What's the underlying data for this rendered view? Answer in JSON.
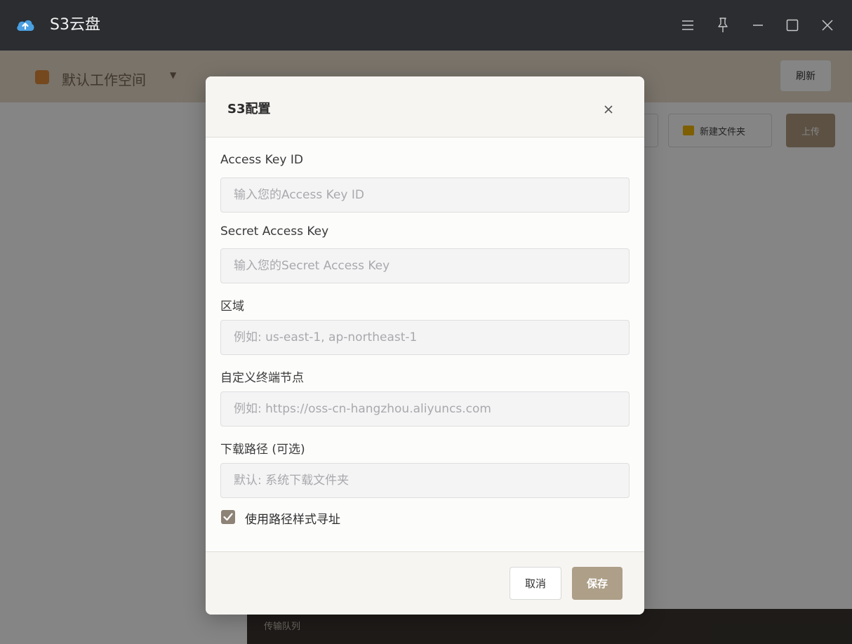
{
  "window": {
    "title": "S3云盘",
    "icons": [
      "cloud-upload-icon",
      "menu-icon",
      "pin-icon",
      "minimize-icon",
      "maximize-icon",
      "close-icon"
    ]
  },
  "background_app": {
    "workspace_label": "默认工作空间",
    "header_button": "刷新",
    "new_folder_button": "新建文件夹",
    "upload_button": "上传",
    "status_text": "传输队列"
  },
  "dialog": {
    "title": "S3配置",
    "fields": [
      {
        "label": "Access Key ID",
        "value": "",
        "placeholder": "输入您的Access Key ID"
      },
      {
        "label": "Secret Access Key",
        "value": "",
        "placeholder": "输入您的Secret Access Key"
      },
      {
        "label": "区域",
        "value": "",
        "placeholder": "例如: us-east-1, ap-northeast-1"
      },
      {
        "label": "自定义终端节点",
        "value": "",
        "placeholder": "例如: https://oss-cn-hangzhou.aliyuncs.com"
      },
      {
        "label": "下载路径 (可选)",
        "value": "",
        "placeholder": "默认: 系统下载文件夹"
      }
    ],
    "checkbox": {
      "label": "使用路径样式寻址",
      "checked": true
    },
    "cancel_label": "取消",
    "save_label": "保存"
  },
  "colors": {
    "titlebar": "#2b2d31",
    "accent": "#ad9f88",
    "checkbox": "#8d8376",
    "app_icon": "#4a9fe0"
  }
}
